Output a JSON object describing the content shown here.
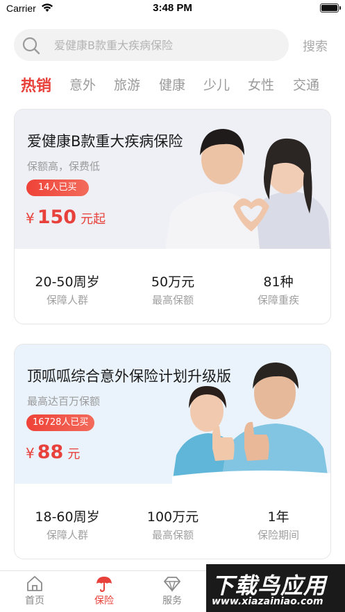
{
  "status_bar": {
    "carrier": "Carrier",
    "time": "3:48 PM"
  },
  "search": {
    "placeholder": "爱健康B款重大疾病保险",
    "button_label": "搜索"
  },
  "tabs": [
    {
      "label": "热销",
      "active": true
    },
    {
      "label": "意外"
    },
    {
      "label": "旅游"
    },
    {
      "label": "健康"
    },
    {
      "label": "少儿"
    },
    {
      "label": "女性"
    },
    {
      "label": "交通"
    }
  ],
  "products": [
    {
      "title": "爱健康B款重大疾病保险",
      "subtitle": "保额高，保费低",
      "buyers": "14人已买",
      "price_symbol": "¥",
      "price": "150",
      "price_unit": "元起",
      "stats": [
        {
          "value": "20-50周岁",
          "label": "保障人群"
        },
        {
          "value": "50万元",
          "label": "最高保额"
        },
        {
          "value": "81种",
          "label": "保障重疾"
        }
      ]
    },
    {
      "title": "顶呱呱综合意外保险计划升级版",
      "subtitle": "最高达百万保额",
      "buyers": "16728人已买",
      "price_symbol": "¥",
      "price": "88",
      "price_unit": "元",
      "stats": [
        {
          "value": "18-60周岁",
          "label": "保障人群"
        },
        {
          "value": "100万元",
          "label": "最高保额"
        },
        {
          "value": "1年",
          "label": "保险期间"
        }
      ]
    }
  ],
  "bottom_nav": [
    {
      "label": "首页",
      "icon": "home-icon"
    },
    {
      "label": "保险",
      "icon": "umbrella-icon",
      "active": true
    },
    {
      "label": "服务",
      "icon": "diamond-icon"
    }
  ],
  "watermark": {
    "main": "下载鸟应用",
    "url": "www.xiazainiao.com"
  },
  "colors": {
    "accent": "#e8403a",
    "muted": "#9b9b9b"
  }
}
